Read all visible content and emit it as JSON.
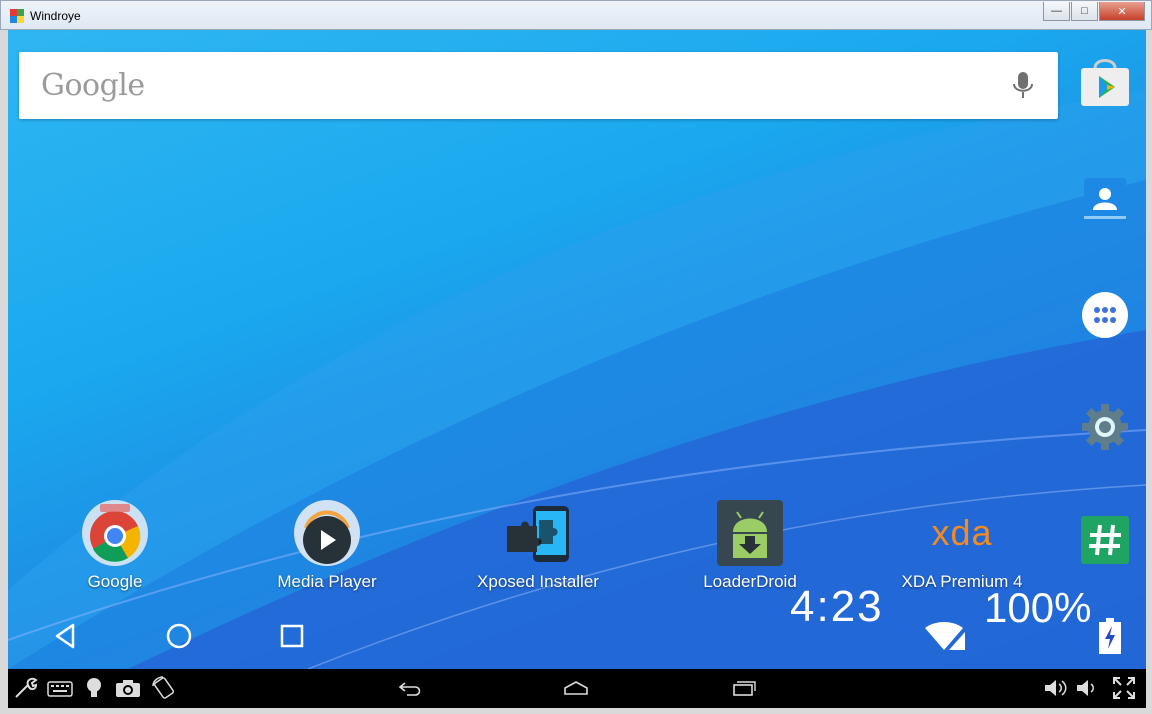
{
  "window": {
    "title": "Windroye"
  },
  "search": {
    "logo": "Google"
  },
  "apps": [
    {
      "label": "Google"
    },
    {
      "label": "Media Player"
    },
    {
      "label": "Xposed Installer"
    },
    {
      "label": "LoaderDroid"
    },
    {
      "label": "XDA Premium 4",
      "logo_text": "xda"
    }
  ],
  "status": {
    "time": "4:23",
    "battery": "100%"
  },
  "dock_icons": [
    "play-store-icon",
    "contacts-icon",
    "app-drawer-icon",
    "settings-icon",
    "hashtag-icon"
  ],
  "toolbar_icons": [
    "wrench-icon",
    "keyboard-icon",
    "lightbulb-icon",
    "camera-icon",
    "rotate-icon",
    "back-arrow-icon",
    "home-icon",
    "recent-apps-icon",
    "volume-up-icon",
    "volume-down-icon",
    "fullscreen-icon"
  ],
  "colors": {
    "accent": "#1aa8ee",
    "xda": "#f58a1f"
  }
}
